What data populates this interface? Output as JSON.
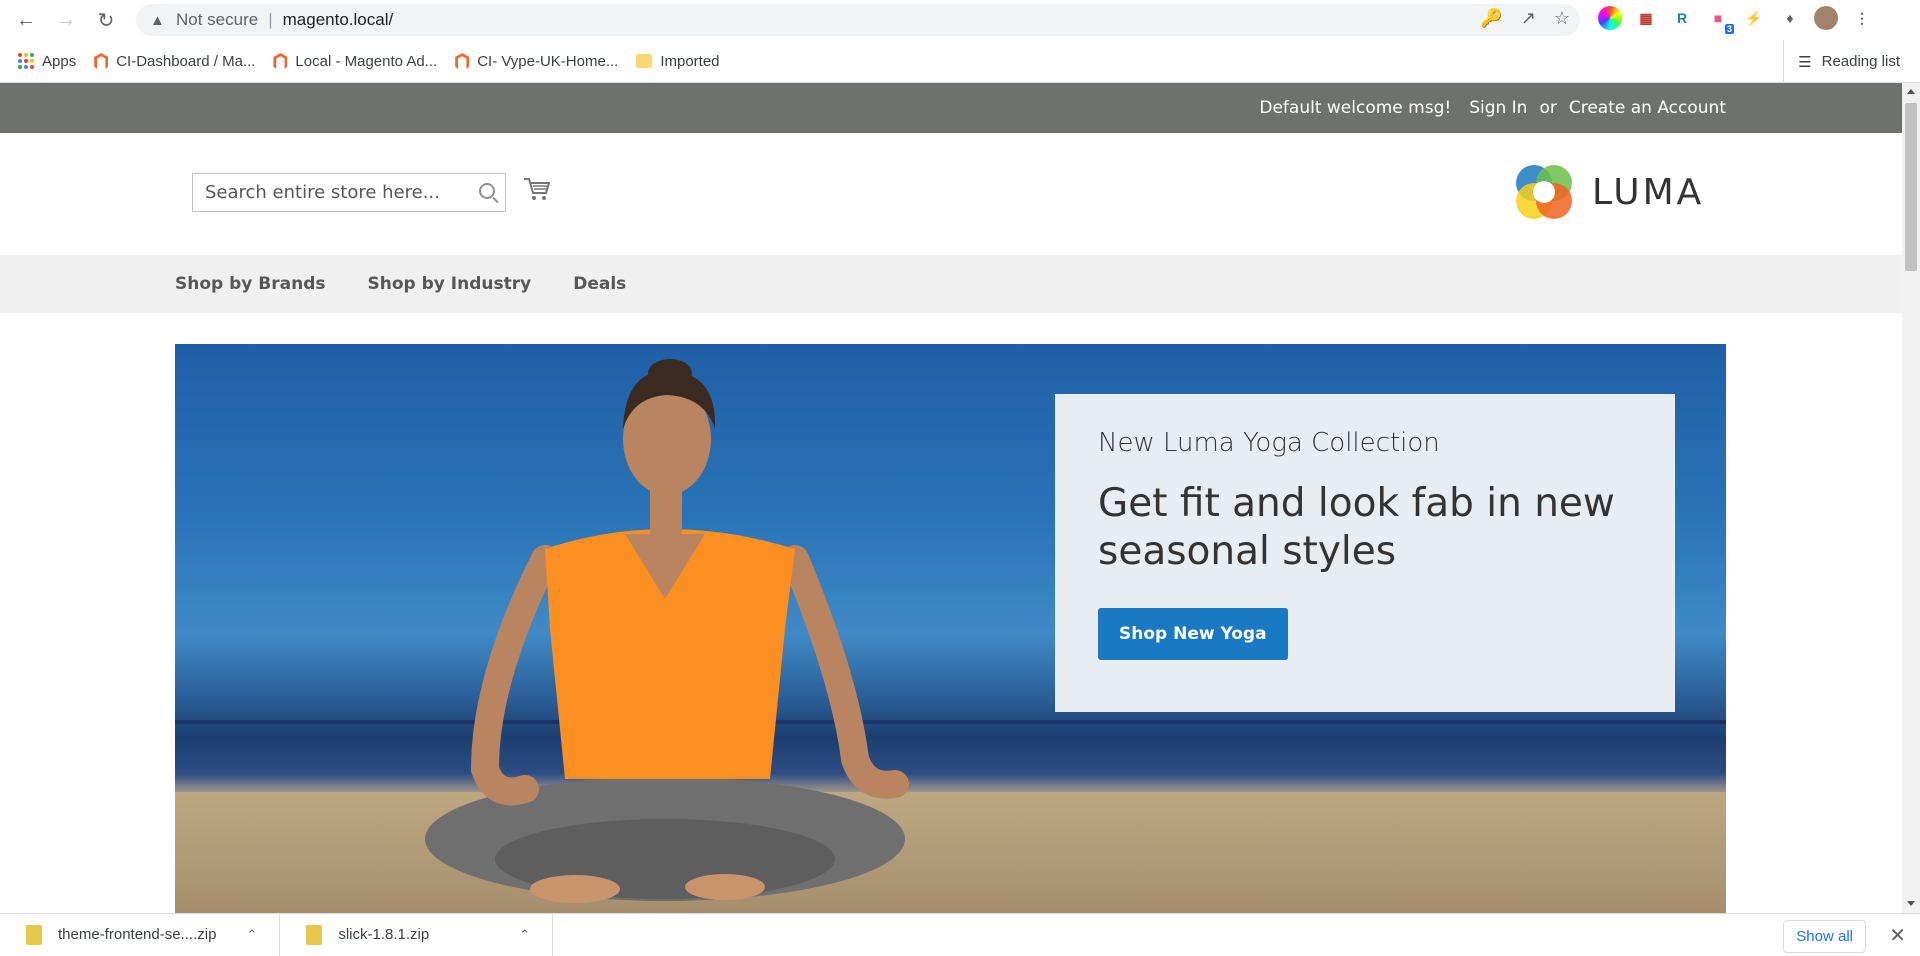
{
  "browser": {
    "security_label": "Not secure",
    "url": "magento.local/",
    "bookmarks": [
      {
        "label": "Apps"
      },
      {
        "label": "CI-Dashboard / Ma..."
      },
      {
        "label": "Local - Magento Ad..."
      },
      {
        "label": "CI- Vype-UK-Home..."
      },
      {
        "label": "Imported"
      }
    ],
    "reading_list": "Reading list",
    "extension_badge": "3"
  },
  "page": {
    "welcome": "Default welcome msg!",
    "sign_in": "Sign In",
    "or": "or",
    "create_account": "Create an Account",
    "search_placeholder": "Search entire store here...",
    "logo_text": "LUMA",
    "nav": [
      "Shop by Brands",
      "Shop by Industry",
      "Deals"
    ],
    "hero": {
      "subtitle": "New Luma Yoga Collection",
      "title": "Get fit and look fab in new seasonal styles",
      "button": "Shop New Yoga"
    }
  },
  "downloads": {
    "items": [
      {
        "name": "theme-frontend-se....zip"
      },
      {
        "name": "slick-1.8.1.zip"
      }
    ],
    "show_all": "Show all"
  },
  "colors": {
    "panel_header": "#6e716e",
    "nav_bg": "#f0f0f0",
    "primary_button": "#1979c3",
    "promo_bg": "#e8edf2"
  }
}
